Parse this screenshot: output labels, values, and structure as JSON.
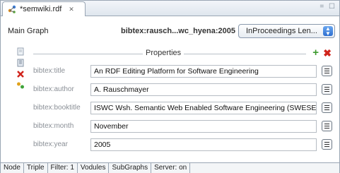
{
  "tab": {
    "title": "*semwiki.rdf",
    "close": "✕",
    "icon": "rdf-file-icon"
  },
  "window_controls": "= ☐",
  "header": {
    "graph_label": "Main Graph",
    "resource_id": "bibtex:rausch...wc_hyena:2005",
    "type_select": {
      "selected": "InProceedings Len..."
    }
  },
  "properties": {
    "title": "Properties",
    "add_icon": "plus-icon",
    "remove_icon": "delete-icon",
    "rows": [
      {
        "label": "bibtex:title",
        "value": "An RDF Editing Platform for Software Engineering"
      },
      {
        "label": "bibtex:author",
        "value": "A. Rauschmayer"
      },
      {
        "label": "bibtex:booktitle",
        "value": "ISWC Wsh. Semantic Web Enabled Software Engineering (SWESE)"
      },
      {
        "label": "bibtex:month",
        "value": "November"
      },
      {
        "label": "bibtex:year",
        "value": "2005"
      }
    ]
  },
  "status_bar": [
    "Node",
    "Triple",
    "Filter: 1",
    "Vodules",
    "SubGraphs",
    "Server: on"
  ]
}
